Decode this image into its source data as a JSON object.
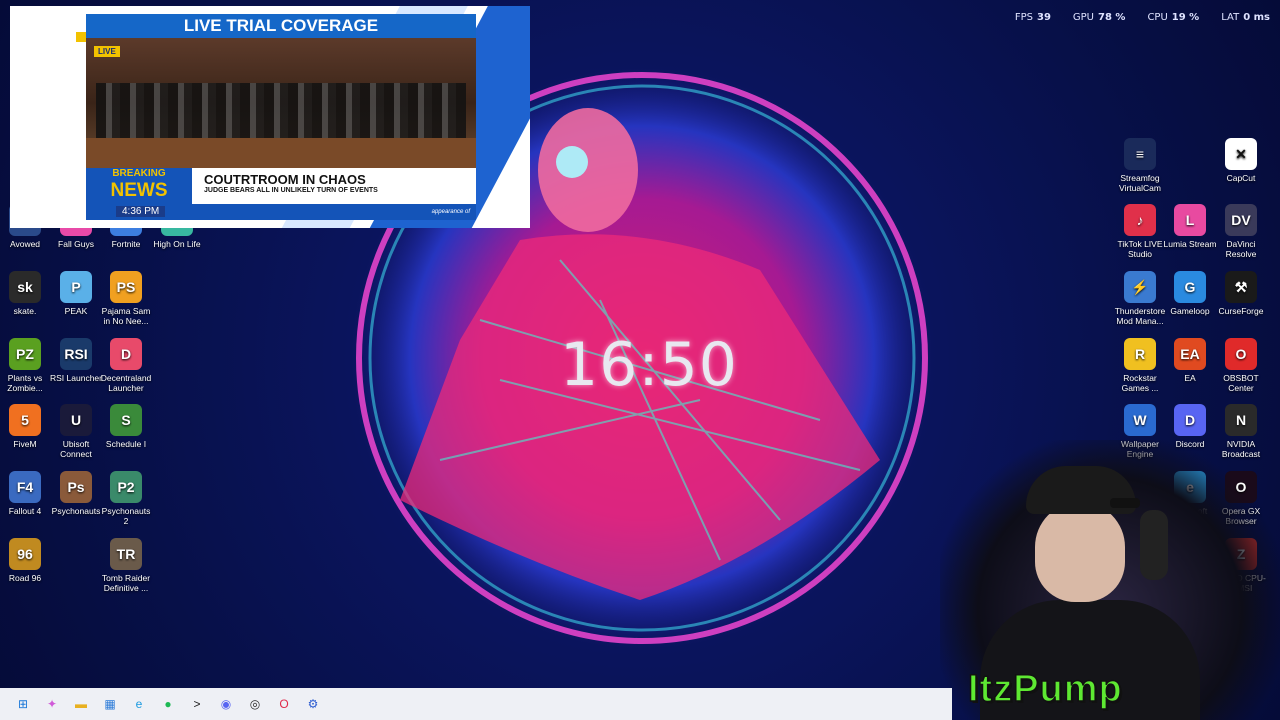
{
  "performance": {
    "fps_label": "FPS",
    "fps_value": "39",
    "gpu_label": "GPU",
    "gpu_value": "78 %",
    "cpu_label": "CPU",
    "cpu_value": "19 %",
    "lat_label": "LAT",
    "lat_value": "0 ms"
  },
  "clock": {
    "time": "16:50"
  },
  "news_overlay": {
    "header": "LIVE TRIAL COVERAGE",
    "live_badge": "LIVE",
    "breaking_1": "BREAKING",
    "breaking_2": "NEWS",
    "headline": "COUTRTROOM IN CHAOS",
    "subheadline": "JUDGE BEARS ALL IN UNLIKELY TURN OF EVENTS",
    "time": "4:36 PM",
    "ticker": "appearance of"
  },
  "left_icons": [
    {
      "label": "Avowed",
      "color": "#2a4a8a",
      "glyph": "A"
    },
    {
      "label": "Fall Guys",
      "color": "#e84aa8",
      "glyph": "FG"
    },
    {
      "label": "Fortnite",
      "color": "#3c7ee0",
      "glyph": "F"
    },
    {
      "label": "High On Life",
      "color": "#38b8a0",
      "glyph": "H"
    },
    {
      "label": "skate.",
      "color": "#2a2a2a",
      "glyph": "sk"
    },
    {
      "label": "PEAK",
      "color": "#5ab0e8",
      "glyph": "P"
    },
    {
      "label": "Pajama Sam in No Nee...",
      "color": "#f0a020",
      "glyph": "PS"
    },
    {
      "label": "Plants vs Zombie...",
      "color": "#5aa020",
      "glyph": "PZ"
    },
    {
      "label": "RSI Launcher",
      "color": "#1a3a6a",
      "glyph": "RSI"
    },
    {
      "label": "Decentraland Launcher",
      "color": "#e84a6a",
      "glyph": "D"
    },
    {
      "label": "FiveM",
      "color": "#f07020",
      "glyph": "5"
    },
    {
      "label": "Ubisoft Connect",
      "color": "#1a1a3a",
      "glyph": "U"
    },
    {
      "label": "Schedule I",
      "color": "#3a8a3a",
      "glyph": "S"
    },
    {
      "label": "Fallout 4",
      "color": "#3a6ac0",
      "glyph": "F4"
    },
    {
      "label": "Psychonauts",
      "color": "#8a5a3a",
      "glyph": "Ps"
    },
    {
      "label": "Psychonauts 2",
      "color": "#3a8a6a",
      "glyph": "P2"
    },
    {
      "label": "Road 96",
      "color": "#c08a20",
      "glyph": "96"
    },
    {
      "label": "Tomb Raider Definitive ...",
      "color": "#6a5a4a",
      "glyph": "TR"
    }
  ],
  "right_icons": [
    {
      "label": "Streamfog VirtualCam",
      "color": "#1a2a5a",
      "glyph": "≡"
    },
    {
      "label": "CapCut",
      "color": "#ffffff",
      "glyph": "✕"
    },
    {
      "label": "TikTok LIVE Studio",
      "color": "#e0304a",
      "glyph": "♪"
    },
    {
      "label": "Lumia Stream",
      "color": "#e84aa0",
      "glyph": "L"
    },
    {
      "label": "DaVinci Resolve",
      "color": "#3a3a5a",
      "glyph": "DV"
    },
    {
      "label": "Thunderstore Mod Mana...",
      "color": "#3a7ad0",
      "glyph": "⚡"
    },
    {
      "label": "Gameloop",
      "color": "#2a8ae0",
      "glyph": "G"
    },
    {
      "label": "CurseForge",
      "color": "#1a1a1a",
      "glyph": "⚒"
    },
    {
      "label": "Rockstar Games ...",
      "color": "#f0c020",
      "glyph": "R"
    },
    {
      "label": "EA",
      "color": "#e04a20",
      "glyph": "EA"
    },
    {
      "label": "OBSBOT Center",
      "color": "#e02a2a",
      "glyph": "O"
    },
    {
      "label": "Wallpaper Engine",
      "color": "#2a6ad0",
      "glyph": "W"
    },
    {
      "label": "Discord",
      "color": "#5865f2",
      "glyph": "D"
    },
    {
      "label": "NVIDIA Broadcast",
      "color": "#2a2a2a",
      "glyph": "N"
    },
    {
      "label": "Microsoft Edge",
      "color": "#2a9ae0",
      "glyph": "e"
    },
    {
      "label": "Opera GX Browser",
      "color": "#1a0a1a",
      "glyph": "O"
    },
    {
      "label": "CPUID CPU-Z MSI",
      "color": "#b02a2a",
      "glyph": "Z"
    }
  ],
  "streamer_name": "ItzPump",
  "taskbar": [
    {
      "name": "start-icon",
      "glyph": "⊞",
      "color": "#1a78d8"
    },
    {
      "name": "copilot-icon",
      "glyph": "✦",
      "color": "#d05ad8"
    },
    {
      "name": "folder-icon",
      "glyph": "▬",
      "color": "#e8b020"
    },
    {
      "name": "store-icon",
      "glyph": "▦",
      "color": "#2a7ad8"
    },
    {
      "name": "edge-icon",
      "glyph": "e",
      "color": "#1a9ae0"
    },
    {
      "name": "spotify-icon",
      "glyph": "●",
      "color": "#1db954"
    },
    {
      "name": "terminal-icon",
      "glyph": ">",
      "color": "#1a1a1a"
    },
    {
      "name": "discord-icon",
      "glyph": "◉",
      "color": "#5865f2"
    },
    {
      "name": "obs-icon",
      "glyph": "◎",
      "color": "#2a2a2a"
    },
    {
      "name": "opera-icon",
      "glyph": "O",
      "color": "#e02a4a"
    },
    {
      "name": "settings-icon",
      "glyph": "⚙",
      "color": "#2a5ad0"
    }
  ]
}
